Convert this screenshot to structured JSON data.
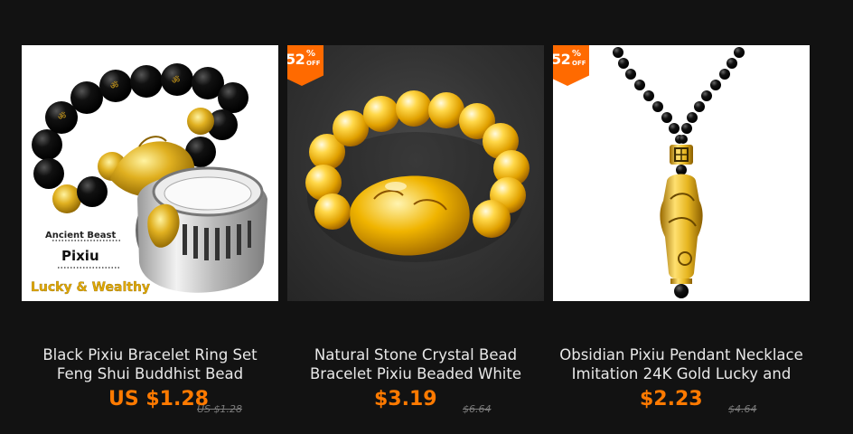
{
  "products": [
    {
      "title": "Black Pixiu Bracelet Ring Set\nFeng Shui Buddhist Bead",
      "price": "US $1.28",
      "original_price": "US $1.28",
      "image_text": {
        "line1": "Ancient Beast",
        "line2": "Pixiu",
        "line3": "Lucky & Wealthy"
      }
    },
    {
      "title": "Natural Stone Crystal Bead\nBracelet Pixiu Beaded White",
      "price": "$3.19",
      "original_price": "$6.64",
      "discount": {
        "percent": "52",
        "symbol": "%",
        "label": "OFF"
      }
    },
    {
      "title": "Obsidian Pixiu Pendant Necklace\nImitation 24K Gold Lucky and",
      "price": "$2.23",
      "original_price": "$4.64",
      "discount": {
        "percent": "52",
        "symbol": "%",
        "label": "OFF"
      }
    }
  ],
  "colors": {
    "background": "#121212",
    "price": "#ff7a00",
    "badge": "#ff6a00"
  }
}
